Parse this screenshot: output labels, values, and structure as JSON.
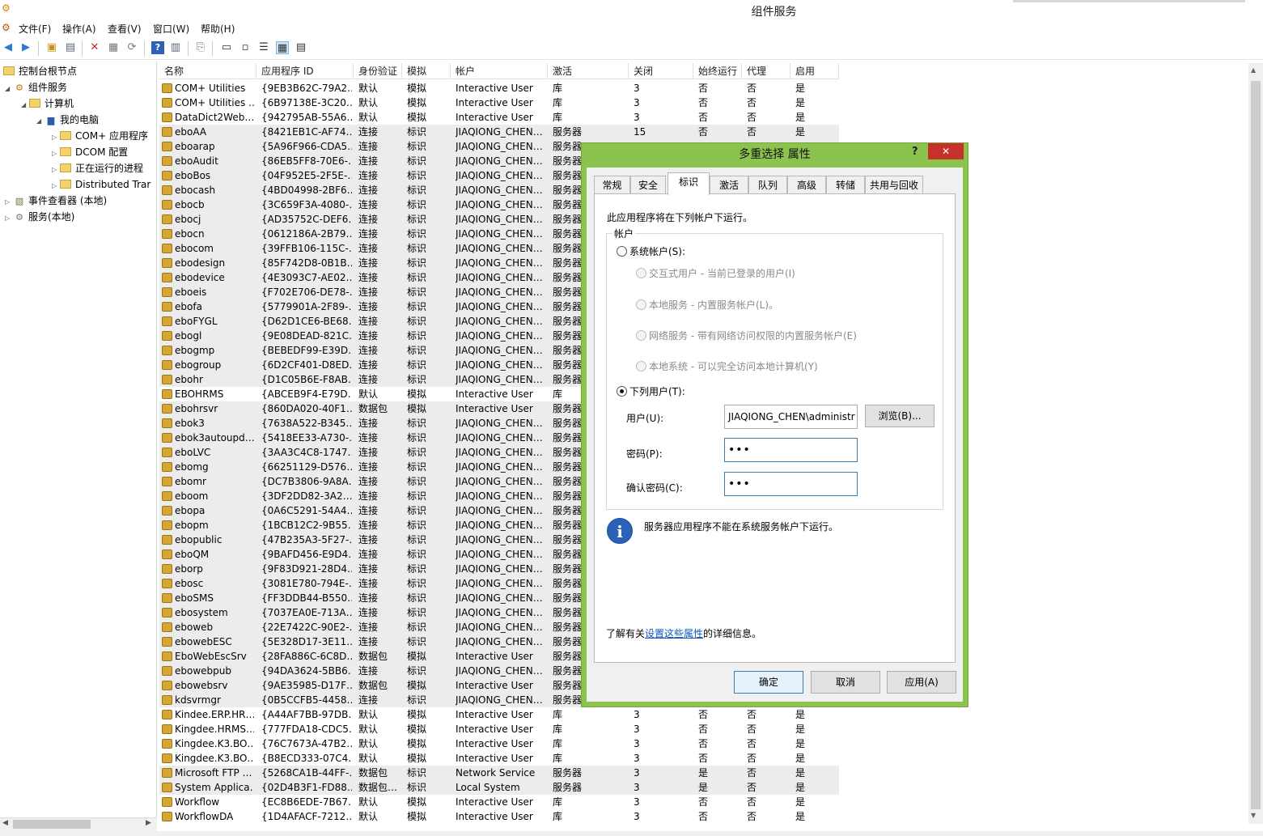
{
  "window": {
    "title": "组件服务"
  },
  "menu": [
    "文件(F)",
    "操作(A)",
    "查看(V)",
    "窗口(W)",
    "帮助(H)"
  ],
  "tree": {
    "root": "控制台根节点",
    "component_services": "组件服务",
    "computers": "计算机",
    "my_computer": "我的电脑",
    "com_apps": "COM+ 应用程序",
    "dcom": "DCOM 配置",
    "running": "正在运行的进程",
    "distributed": "Distributed Trar",
    "event_viewer": "事件查看器 (本地)",
    "services": "服务(本地)"
  },
  "columns": [
    "名称",
    "应用程序 ID",
    "身份验证",
    "模拟",
    "帐户",
    "激活",
    "关闭",
    "始终运行",
    "代理",
    "启用"
  ],
  "rows": [
    [
      "COM+ Utilities",
      "{9EB3B62C-79A2…",
      "默认",
      "模拟",
      "Interactive User",
      "库",
      "3",
      "否",
      "否",
      "是",
      "u"
    ],
    [
      "COM+ Utilities …",
      "{6B97138E-3C20…",
      "默认",
      "模拟",
      "Interactive User",
      "库",
      "3",
      "否",
      "否",
      "是",
      "u"
    ],
    [
      "DataDict2Web…",
      "{942795AB-55A6…",
      "默认",
      "模拟",
      "Interactive User",
      "库",
      "3",
      "否",
      "否",
      "是",
      "u"
    ],
    [
      "eboAA",
      "{8421EB1C-AF74…",
      "连接",
      "标识",
      "JIAQIONG_CHEN…",
      "服务器",
      "15",
      "否",
      "否",
      "是",
      "s"
    ],
    [
      "eboarap",
      "{5A96F966-CDA5…",
      "连接",
      "标识",
      "JIAQIONG_CHEN…",
      "服务器",
      "",
      "",
      "",
      "",
      "s"
    ],
    [
      "eboAudit",
      "{86EB5FF8-70E6-…",
      "连接",
      "标识",
      "JIAQIONG_CHEN…",
      "服务器",
      "",
      "",
      "",
      "",
      "s"
    ],
    [
      "eboBos",
      "{04F952E5-2F5E-…",
      "连接",
      "标识",
      "JIAQIONG_CHEN…",
      "服务器",
      "",
      "",
      "",
      "",
      "s"
    ],
    [
      "ebocash",
      "{4BD04998-2BF6…",
      "连接",
      "标识",
      "JIAQIONG_CHEN…",
      "服务器",
      "",
      "",
      "",
      "",
      "s"
    ],
    [
      "ebocb",
      "{3C659F3A-4080-…",
      "连接",
      "标识",
      "JIAQIONG_CHEN…",
      "服务器",
      "",
      "",
      "",
      "",
      "s"
    ],
    [
      "ebocj",
      "{AD35752C-DEF6…",
      "连接",
      "标识",
      "JIAQIONG_CHEN…",
      "服务器",
      "",
      "",
      "",
      "",
      "s"
    ],
    [
      "ebocn",
      "{0612186A-2B79…",
      "连接",
      "标识",
      "JIAQIONG_CHEN…",
      "服务器",
      "",
      "",
      "",
      "",
      "s"
    ],
    [
      "ebocom",
      "{39FFB106-115C-…",
      "连接",
      "标识",
      "JIAQIONG_CHEN…",
      "服务器",
      "",
      "",
      "",
      "",
      "s"
    ],
    [
      "ebodesign",
      "{85F742D8-0B1B…",
      "连接",
      "标识",
      "JIAQIONG_CHEN…",
      "服务器",
      "",
      "",
      "",
      "",
      "s"
    ],
    [
      "ebodevice",
      "{4E3093C7-AE02…",
      "连接",
      "标识",
      "JIAQIONG_CHEN…",
      "服务器",
      "",
      "",
      "",
      "",
      "s"
    ],
    [
      "eboeis",
      "{F702E706-DE78-…",
      "连接",
      "标识",
      "JIAQIONG_CHEN…",
      "服务器",
      "",
      "",
      "",
      "",
      "s"
    ],
    [
      "ebofa",
      "{5779901A-2F89-…",
      "连接",
      "标识",
      "JIAQIONG_CHEN…",
      "服务器",
      "",
      "",
      "",
      "",
      "s"
    ],
    [
      "eboFYGL",
      "{D62D1CE6-BE68…",
      "连接",
      "标识",
      "JIAQIONG_CHEN…",
      "服务器",
      "",
      "",
      "",
      "",
      "s"
    ],
    [
      "ebogl",
      "{9E08DEAD-821C…",
      "连接",
      "标识",
      "JIAQIONG_CHEN…",
      "服务器",
      "",
      "",
      "",
      "",
      "s"
    ],
    [
      "ebogmp",
      "{BEBEDF99-E39D…",
      "连接",
      "标识",
      "JIAQIONG_CHEN…",
      "服务器",
      "",
      "",
      "",
      "",
      "s"
    ],
    [
      "ebogroup",
      "{6D2CF401-D8ED…",
      "连接",
      "标识",
      "JIAQIONG_CHEN…",
      "服务器",
      "",
      "",
      "",
      "",
      "s"
    ],
    [
      "ebohr",
      "{D1C05B6E-F8AB…",
      "连接",
      "标识",
      "JIAQIONG_CHEN…",
      "服务器",
      "",
      "",
      "",
      "",
      "s"
    ],
    [
      "EBOHRMS",
      "{ABCEB9F4-E79D…",
      "默认",
      "模拟",
      "Interactive User",
      "库",
      "",
      "",
      "",
      "",
      "u"
    ],
    [
      "ebohrsvr",
      "{860DA020-40F1…",
      "数据包",
      "模拟",
      "Interactive User",
      "服务器",
      "",
      "",
      "",
      "",
      "s"
    ],
    [
      "ebok3",
      "{7638A522-B345…",
      "连接",
      "标识",
      "JIAQIONG_CHEN…",
      "服务器",
      "",
      "",
      "",
      "",
      "s"
    ],
    [
      "ebok3autoupd…",
      "{5418EE33-A730-…",
      "连接",
      "标识",
      "JIAQIONG_CHEN…",
      "服务器",
      "",
      "",
      "",
      "",
      "s"
    ],
    [
      "eboLVC",
      "{3AA3C4C8-1747…",
      "连接",
      "标识",
      "JIAQIONG_CHEN…",
      "服务器",
      "",
      "",
      "",
      "",
      "s"
    ],
    [
      "ebomg",
      "{66251129-D576…",
      "连接",
      "标识",
      "JIAQIONG_CHEN…",
      "服务器",
      "",
      "",
      "",
      "",
      "s"
    ],
    [
      "ebomr",
      "{DC7B3806-9A8A…",
      "连接",
      "标识",
      "JIAQIONG_CHEN…",
      "服务器",
      "",
      "",
      "",
      "",
      "s"
    ],
    [
      "eboom",
      "{3DF2DD82-3A2…",
      "连接",
      "标识",
      "JIAQIONG_CHEN…",
      "服务器",
      "",
      "",
      "",
      "",
      "s"
    ],
    [
      "ebopa",
      "{0A6C5291-54A4…",
      "连接",
      "标识",
      "JIAQIONG_CHEN…",
      "服务器",
      "",
      "",
      "",
      "",
      "s"
    ],
    [
      "ebopm",
      "{1BCB12C2-9B55…",
      "连接",
      "标识",
      "JIAQIONG_CHEN…",
      "服务器",
      "",
      "",
      "",
      "",
      "s"
    ],
    [
      "ebopublic",
      "{47B235A3-5F27-…",
      "连接",
      "标识",
      "JIAQIONG_CHEN…",
      "服务器",
      "",
      "",
      "",
      "",
      "s"
    ],
    [
      "eboQM",
      "{9BAFD456-E9D4…",
      "连接",
      "标识",
      "JIAQIONG_CHEN…",
      "服务器",
      "",
      "",
      "",
      "",
      "s"
    ],
    [
      "eborp",
      "{9F83D921-28D4…",
      "连接",
      "标识",
      "JIAQIONG_CHEN…",
      "服务器",
      "",
      "",
      "",
      "",
      "s"
    ],
    [
      "ebosc",
      "{3081E780-794E-…",
      "连接",
      "标识",
      "JIAQIONG_CHEN…",
      "服务器",
      "",
      "",
      "",
      "",
      "s"
    ],
    [
      "eboSMS",
      "{FF3DDB44-B550…",
      "连接",
      "标识",
      "JIAQIONG_CHEN…",
      "服务器",
      "",
      "",
      "",
      "",
      "s"
    ],
    [
      "ebosystem",
      "{7037EA0E-713A…",
      "连接",
      "标识",
      "JIAQIONG_CHEN…",
      "服务器",
      "",
      "",
      "",
      "",
      "s"
    ],
    [
      "eboweb",
      "{22E7422C-90E2-…",
      "连接",
      "标识",
      "JIAQIONG_CHEN…",
      "服务器",
      "",
      "",
      "",
      "",
      "s"
    ],
    [
      "ebowebESC",
      "{5E328D17-3E11…",
      "连接",
      "标识",
      "JIAQIONG_CHEN…",
      "服务器",
      "",
      "",
      "",
      "",
      "s"
    ],
    [
      "EboWebEscSrv",
      "{28FA886C-6C8D…",
      "数据包",
      "模拟",
      "Interactive User",
      "服务器",
      "",
      "",
      "",
      "",
      "s"
    ],
    [
      "ebowebpub",
      "{94DA3624-5BB6…",
      "连接",
      "标识",
      "JIAQIONG_CHEN…",
      "服务器",
      "",
      "",
      "",
      "",
      "s"
    ],
    [
      "ebowebsrv",
      "{9AE35985-D17F…",
      "数据包",
      "模拟",
      "Interactive User",
      "服务器",
      "",
      "",
      "",
      "",
      "s"
    ],
    [
      "kdsvrmgr",
      "{0B5CCFB5-4458…",
      "连接",
      "标识",
      "JIAQIONG_CHEN…",
      "服务器",
      "",
      "",
      "",
      "",
      "s"
    ],
    [
      "Kindee.ERP.HR…",
      "{A44AF7BB-97DB…",
      "默认",
      "模拟",
      "Interactive User",
      "库",
      "3",
      "否",
      "否",
      "是",
      "u"
    ],
    [
      "Kingdee.HRMS…",
      "{777FDA18-CDC5…",
      "默认",
      "模拟",
      "Interactive User",
      "库",
      "3",
      "否",
      "否",
      "是",
      "u"
    ],
    [
      "Kingdee.K3.BO…",
      "{76C7673A-47B2…",
      "默认",
      "模拟",
      "Interactive User",
      "库",
      "3",
      "否",
      "否",
      "是",
      "u"
    ],
    [
      "Kingdee.K3.BO…",
      "{B8ECD333-07C4…",
      "默认",
      "模拟",
      "Interactive User",
      "库",
      "3",
      "否",
      "否",
      "是",
      "u"
    ],
    [
      "Microsoft FTP …",
      "{5268CA1B-44FF-…",
      "数据包",
      "标识",
      "Network Service",
      "服务器",
      "3",
      "是",
      "否",
      "是",
      "s"
    ],
    [
      "System Applica…",
      "{02D4B3F1-FD88…",
      "数据包…",
      "标识",
      "Local System",
      "服务器",
      "3",
      "是",
      "否",
      "是",
      "s"
    ],
    [
      "Workflow",
      "{EC8B6EDE-7B67…",
      "默认",
      "模拟",
      "Interactive User",
      "库",
      "3",
      "否",
      "否",
      "是",
      "u"
    ],
    [
      "WorkflowDA",
      "{1D4AFACF-7212…",
      "默认",
      "模拟",
      "Interactive User",
      "库",
      "3",
      "否",
      "否",
      "是",
      "u"
    ]
  ],
  "dialog": {
    "title": "多重选择 属性",
    "help": "?",
    "close": "✕",
    "tabs": [
      "常规",
      "安全",
      "标识",
      "激活",
      "队列",
      "高级",
      "转储",
      "共用与回收"
    ],
    "active_tab": "标识",
    "intro": "此应用程序将在下列帐户下运行。",
    "group_label": "帐户",
    "system_account": "系统帐户(S):",
    "sub_options": [
      "交互式用户 - 当前已登录的用户(I)",
      "本地服务 - 内置服务帐户(L)。",
      "网络服务 - 带有网络访问权限的内置服务帐户(E)",
      "本地系统 - 可以完全访问本地计算机(Y)"
    ],
    "this_user": "下列用户(T):",
    "user_label": "用户(U):",
    "user_value": "JIAQIONG_CHEN\\administr",
    "browse": "浏览(B)...",
    "password_label": "密码(P):",
    "password_value": "•••",
    "confirm_label": "确认密码(C):",
    "confirm_value": "•••",
    "info_text": "服务器应用程序不能在系统服务帐户下运行。",
    "learn_pre": "了解有关",
    "learn_link": "设置这些属性",
    "learn_post": "的详细信息。",
    "ok": "确定",
    "cancel": "取消",
    "apply": "应用(A)"
  }
}
